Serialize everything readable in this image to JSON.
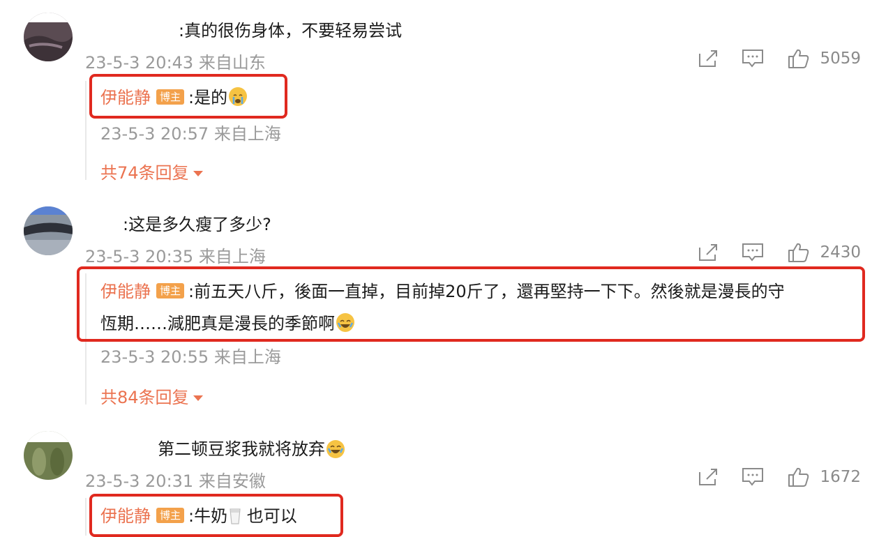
{
  "comments": [
    {
      "text": ":真的很伤身体，不要轻易尝试",
      "time": "23-5-3 20:43",
      "location": "来自山东",
      "likes": "5059",
      "reply": {
        "author": "伊能静",
        "badge": "博主",
        "text": ":是的",
        "time": "23-5-3 20:57",
        "location": "来自上海"
      },
      "more_replies": "共74条回复"
    },
    {
      "text": ":这是多久瘦了多少?",
      "time": "23-5-3 20:35",
      "location": "来自上海",
      "likes": "2430",
      "reply": {
        "author": "伊能静",
        "badge": "博主",
        "text_line1": ":前五天八斤，後面一直掉，目前掉20斤了，還再堅持一下下。然後就是漫長的守",
        "text_line2": "恆期……減肥真是漫長的季節啊",
        "time": "23-5-3 20:55",
        "location": "来自上海"
      },
      "more_replies": "共84条回复"
    },
    {
      "text": "第二顿豆浆我就将放弃",
      "time": "23-5-3 20:31",
      "location": "来自安徽",
      "likes": "1672",
      "reply": {
        "author": "伊能静",
        "badge": "博主",
        "text_a": ":牛奶",
        "text_b": "也可以"
      }
    }
  ],
  "icons": {
    "share": "share-icon",
    "comment": "comment-icon",
    "like": "like-icon",
    "emoji_cry": "crying-emoji-icon",
    "emoji_laugh": "laughing-emoji-icon",
    "emoji_milk": "milk-cup-icon"
  },
  "colors": {
    "author": "#eb7350",
    "badge": "#f3a14b",
    "highlight": "#e0291f",
    "meta": "#9a9a9a"
  }
}
